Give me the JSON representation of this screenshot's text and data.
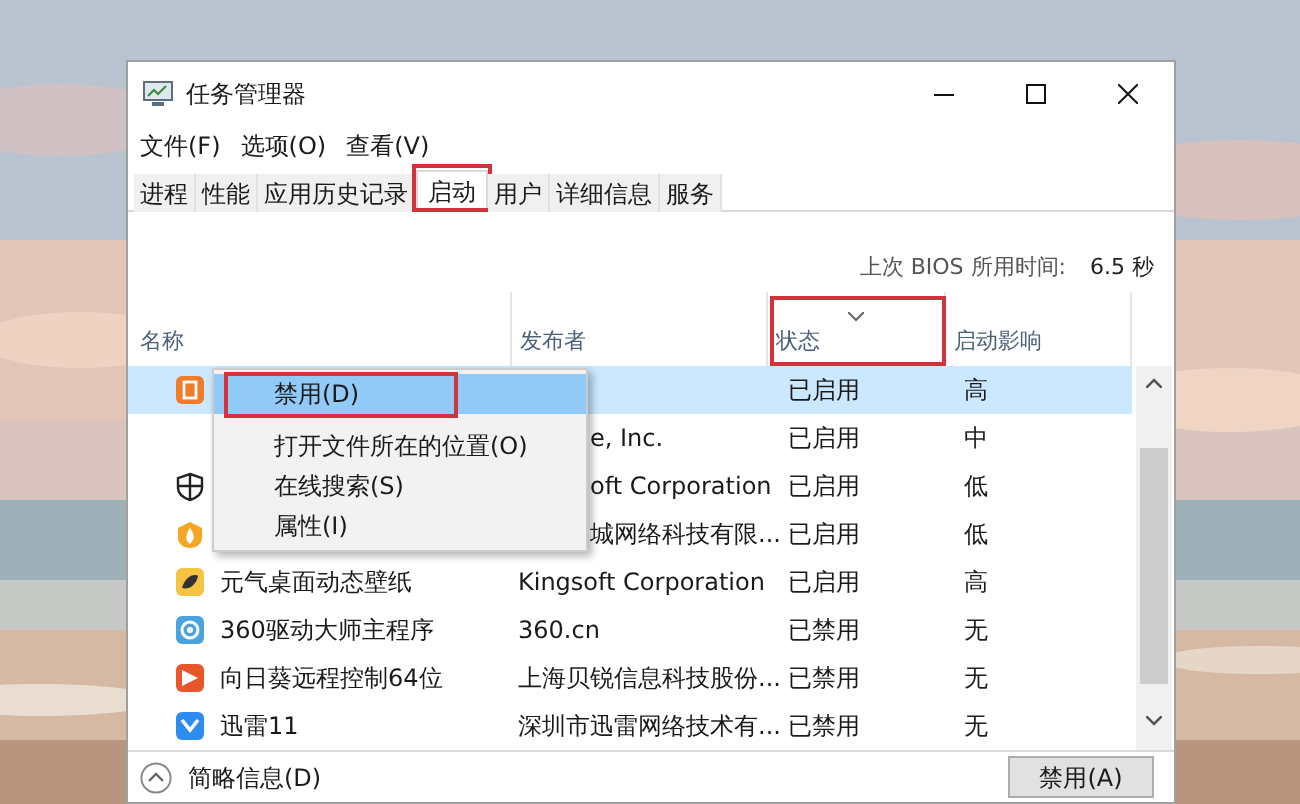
{
  "window": {
    "title": "任务管理器"
  },
  "menu": [
    "文件(F)",
    "选项(O)",
    "查看(V)"
  ],
  "tabs": [
    {
      "label": "进程",
      "selected": false,
      "annotated": false
    },
    {
      "label": "性能",
      "selected": false,
      "annotated": false
    },
    {
      "label": "应用历史记录",
      "selected": false,
      "annotated": false
    },
    {
      "label": "启动",
      "selected": true,
      "annotated": true
    },
    {
      "label": "用户",
      "selected": false,
      "annotated": false
    },
    {
      "label": "详细信息",
      "selected": false,
      "annotated": false
    },
    {
      "label": "服务",
      "selected": false,
      "annotated": false
    }
  ],
  "bios": {
    "label": "上次 BIOS 所用时间:",
    "value": "6.5 秒"
  },
  "columns": [
    {
      "label": "名称",
      "sorted": false,
      "annotated": false
    },
    {
      "label": "发布者",
      "sorted": false,
      "annotated": false
    },
    {
      "label": "状态",
      "sorted": true,
      "annotated": true
    },
    {
      "label": "启动影响",
      "sorted": false,
      "annotated": false
    }
  ],
  "rows": [
    {
      "kind": "orange-tile",
      "status": "已启用",
      "impact": "高",
      "selected": true
    },
    {
      "kind": "none",
      "publisher": "e, Inc.",
      "publisher_covered": true,
      "status": "已启用",
      "impact": "中",
      "selected": false
    },
    {
      "kind": "shield",
      "publisher": "oft Corporation",
      "publisher_covered": true,
      "status": "已启用",
      "impact": "低",
      "selected": false
    },
    {
      "kind": "flame",
      "publisher": "城网络科技有限...",
      "publisher_covered": true,
      "status": "已启用",
      "impact": "低",
      "selected": false
    },
    {
      "kind": "leaf",
      "name": "元气桌面动态壁纸",
      "publisher": "Kingsoft Corporation",
      "publisher_covered": false,
      "status": "已启用",
      "impact": "高",
      "selected": false
    },
    {
      "kind": "ring",
      "name": "360驱动大师主程序",
      "publisher": "360.cn",
      "publisher_covered": false,
      "status": "已禁用",
      "impact": "无",
      "selected": false
    },
    {
      "kind": "flag",
      "name": "向日葵远程控制64位",
      "publisher": "上海贝锐信息科技股份...",
      "publisher_covered": false,
      "status": "已禁用",
      "impact": "无",
      "selected": false
    },
    {
      "kind": "bird",
      "name": "迅雷11",
      "publisher": "深圳市迅雷网络技术有...",
      "publisher_covered": false,
      "status": "已禁用",
      "impact": "无",
      "selected": false
    }
  ],
  "context_menu": [
    {
      "label": "禁用(D)",
      "selected": true,
      "annotated": true
    },
    {
      "label": "打开文件所在的位置(O)",
      "selected": false,
      "annotated": false
    },
    {
      "label": "在线搜索(S)",
      "selected": false,
      "annotated": false
    },
    {
      "label": "属性(I)",
      "selected": false,
      "annotated": false
    }
  ],
  "footer": {
    "details": "简略信息(D)",
    "button": "禁用(A)"
  }
}
